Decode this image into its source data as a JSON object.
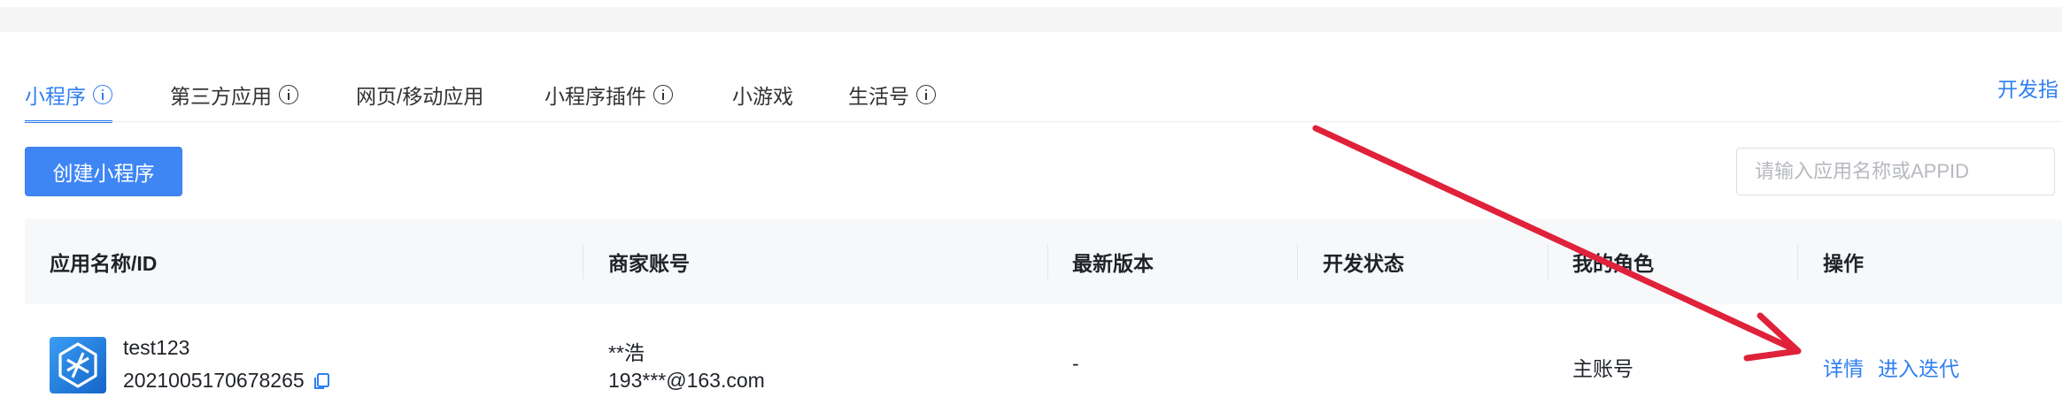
{
  "tabs": [
    {
      "label": "小程序",
      "has_info": true,
      "active": true
    },
    {
      "label": "第三方应用",
      "has_info": true,
      "active": false
    },
    {
      "label": "网页/移动应用",
      "has_info": false,
      "active": false
    },
    {
      "label": "小程序插件",
      "has_info": true,
      "active": false
    },
    {
      "label": "小游戏",
      "has_info": false,
      "active": false
    },
    {
      "label": "生活号",
      "has_info": true,
      "active": false
    }
  ],
  "dev_guide_label": "开发指",
  "create_button_label": "创建小程序",
  "search": {
    "placeholder": "请输入应用名称或APPID"
  },
  "table": {
    "headers": [
      "应用名称/ID",
      "商家账号",
      "最新版本",
      "开发状态",
      "我的角色",
      "操作"
    ],
    "rows": [
      {
        "app_name": "test123",
        "app_id": "2021005170678265",
        "merchant_name": "**浩",
        "merchant_account": "193***@163.com",
        "latest_version": "-",
        "dev_status": "",
        "my_role": "主账号",
        "actions": [
          "详情",
          "进入迭代"
        ]
      }
    ]
  },
  "colors": {
    "accent": "#2f7ff1",
    "button": "#3f86f5",
    "arrow": "#e0213a"
  },
  "icons": [
    "info-icon",
    "copy-icon",
    "app-logo-icon",
    "annotation-arrow"
  ]
}
